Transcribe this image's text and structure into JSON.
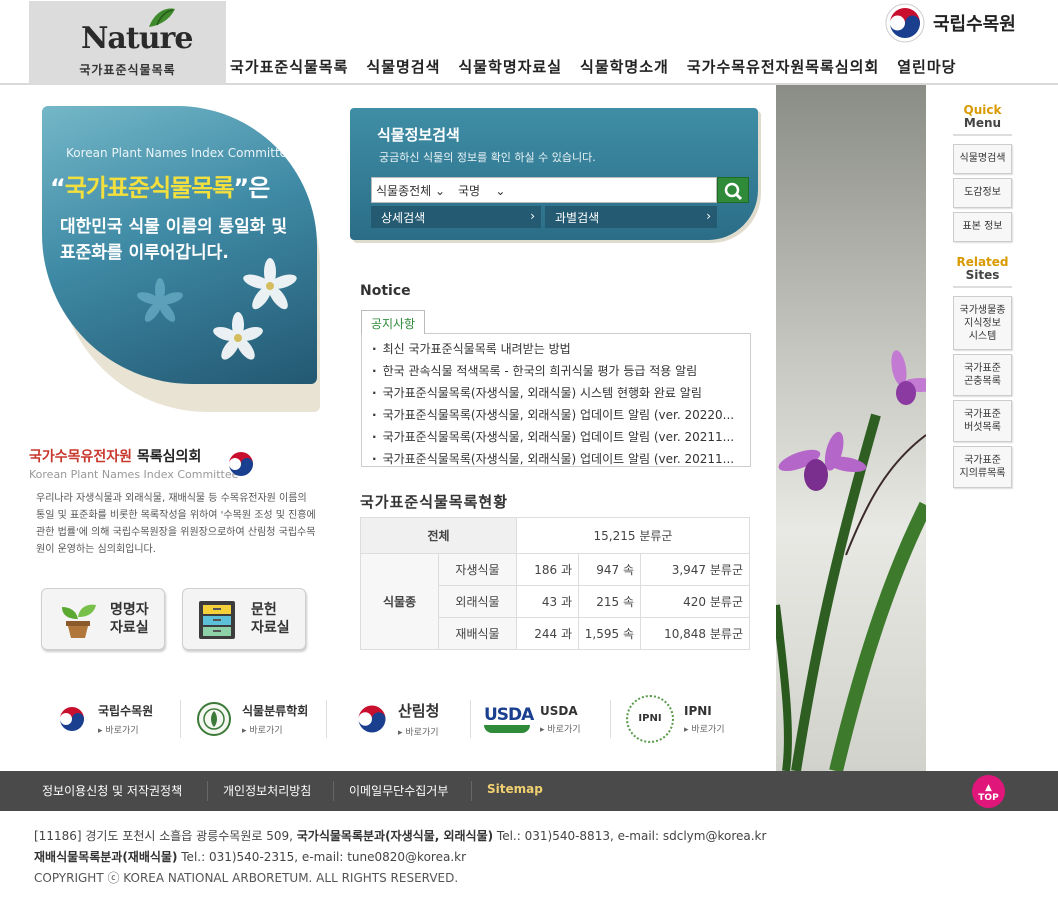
{
  "header": {
    "logo_word": "Nature",
    "logo_sub": "국가표준식물목록",
    "brand_name": "국립수목원",
    "nav": [
      "국가표준식물목록",
      "식물명검색",
      "식물학명자료실",
      "식물학명소개",
      "국가수목유전자원목록심의회",
      "열린마당"
    ]
  },
  "hero": {
    "en": "Korean Plant Names Index Committee",
    "quote_open": "“",
    "highlight": "국가표준식물목록",
    "quote_close": "”",
    "particle": "은",
    "line1": "대한민국 식물 이름의 통일화 및",
    "line2": "표준화를 이루어갑니다."
  },
  "committee": {
    "title_red": "국가수목유전자원",
    "title_rest": " 목록심의회",
    "en": "Korean Plant Names Index Committee",
    "desc": "우리나라 자생식물과 외래식물, 재배식물 등 수목유전자원 이름의 통일 및 표준화를 비롯한 목록작성을 위하여 '수목원 조성 및 진흥에 관한 법률'에 의해 국립수목원장을 위원장으로하여 산림청 국립수목원이 운영하는 심의회입니다."
  },
  "buttons": {
    "namer_l1": "명명자",
    "namer_l2": "자료실",
    "lit_l1": "문헌",
    "lit_l2": "자료실"
  },
  "search": {
    "title": "식물정보검색",
    "subtitle": "궁금하신 식물의 정보를 확인 하실 수 있습니다.",
    "category": "식물종전체",
    "field": "국명",
    "detail_tab": "상세검색",
    "family_tab": "과별검색"
  },
  "notice": {
    "heading": "Notice",
    "tab": "공지사항",
    "items": [
      "최신 국가표준식물목록 내려받는 방법",
      "한국 관속식물 적색목록 - 한국의 희귀식물 평가 등급 적용 알림",
      "국가표준식물목록(자생식물, 외래식물) 시스템 현행화 완료 알림",
      "국가표준식물목록(자생식물, 외래식물) 업데이트 알림 (ver. 20220...",
      "국가표준식물목록(자생식물, 외래식물) 업데이트 알림 (ver. 20211...",
      "국가표준식물목록(자생식물, 외래식물) 업데이트 알림 (ver. 20211..."
    ]
  },
  "status": {
    "heading": "국가표준식물목록현황",
    "total_label": "전체",
    "total_value": "15,215 분류군",
    "group_label": "식물종",
    "rows": [
      {
        "label": "자생식물",
        "family": "186 과",
        "genus": "947 속",
        "taxa": "3,947 분류군"
      },
      {
        "label": "외래식물",
        "family": "43 과",
        "genus": "215 속",
        "taxa": "420 분류군"
      },
      {
        "label": "재배식물",
        "family": "244 과",
        "genus": "1,595 속",
        "taxa": "10,848 분류군"
      }
    ]
  },
  "quick": {
    "title1": "Quick",
    "title2": "Menu",
    "items": [
      "식물명검색",
      "도감정보",
      "표본 정보"
    ],
    "related1": "Related",
    "related2": "Sites",
    "related_items": [
      [
        "국가생물종",
        "지식정보",
        "시스템"
      ],
      [
        "국가표준",
        "곤충목록"
      ],
      [
        "국가표준",
        "버섯목록"
      ],
      [
        "국가표준",
        "지의류목록"
      ]
    ]
  },
  "partners": {
    "go": "바로가기",
    "names": [
      "국립수목원",
      "식물분류학회",
      "산림청",
      "USDA",
      "IPNI"
    ],
    "usda_logo": "USDA",
    "ipni_logo": "IPNI"
  },
  "footer": {
    "links": [
      "정보이용신청 및 저작권정책",
      "개인정보처리방침",
      "이메일무단수집거부",
      "Sitemap"
    ],
    "top": "TOP",
    "addr_pre": "[11186] 경기도 포천시 소흘읍 광릉수목원로 509, ",
    "addr_b1": "국가식물목록분과(자생식물, 외래식물)",
    "addr_post1": " Tel.: 031)540-8813, e-mail: sdclym@korea.kr",
    "addr_b2": "재배식물목록분과(재배식물)",
    "addr_post2": " Tel.: 031)540-2315, e-mail: tune0820@korea.kr",
    "copyright": "COPYRIGHT ⓒ KOREA NATIONAL ARBORETUM. ALL RIGHTS RESERVED."
  }
}
